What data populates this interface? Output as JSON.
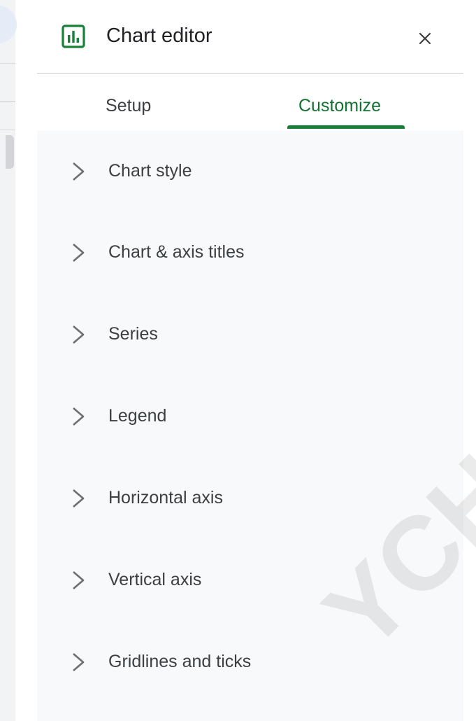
{
  "panel": {
    "title": "Chart editor",
    "title_icon": "bar-chart-icon",
    "close_icon": "close-icon"
  },
  "tabs": [
    {
      "label": "Setup",
      "active": false
    },
    {
      "label": "Customize",
      "active": true
    }
  ],
  "colors": {
    "accent": "#188038",
    "accent_text": "#137333",
    "panel_bg": "#f8f9fa",
    "text": "#3c4043"
  },
  "sections": [
    {
      "label": "Chart style",
      "icon": "chevron-right-icon"
    },
    {
      "label": "Chart & axis titles",
      "icon": "chevron-right-icon"
    },
    {
      "label": "Series",
      "icon": "chevron-right-icon"
    },
    {
      "label": "Legend",
      "icon": "chevron-right-icon"
    },
    {
      "label": "Horizontal axis",
      "icon": "chevron-right-icon"
    },
    {
      "label": "Vertical axis",
      "icon": "chevron-right-icon"
    },
    {
      "label": "Gridlines and ticks",
      "icon": "chevron-right-icon"
    }
  ],
  "watermark": "YCHO"
}
